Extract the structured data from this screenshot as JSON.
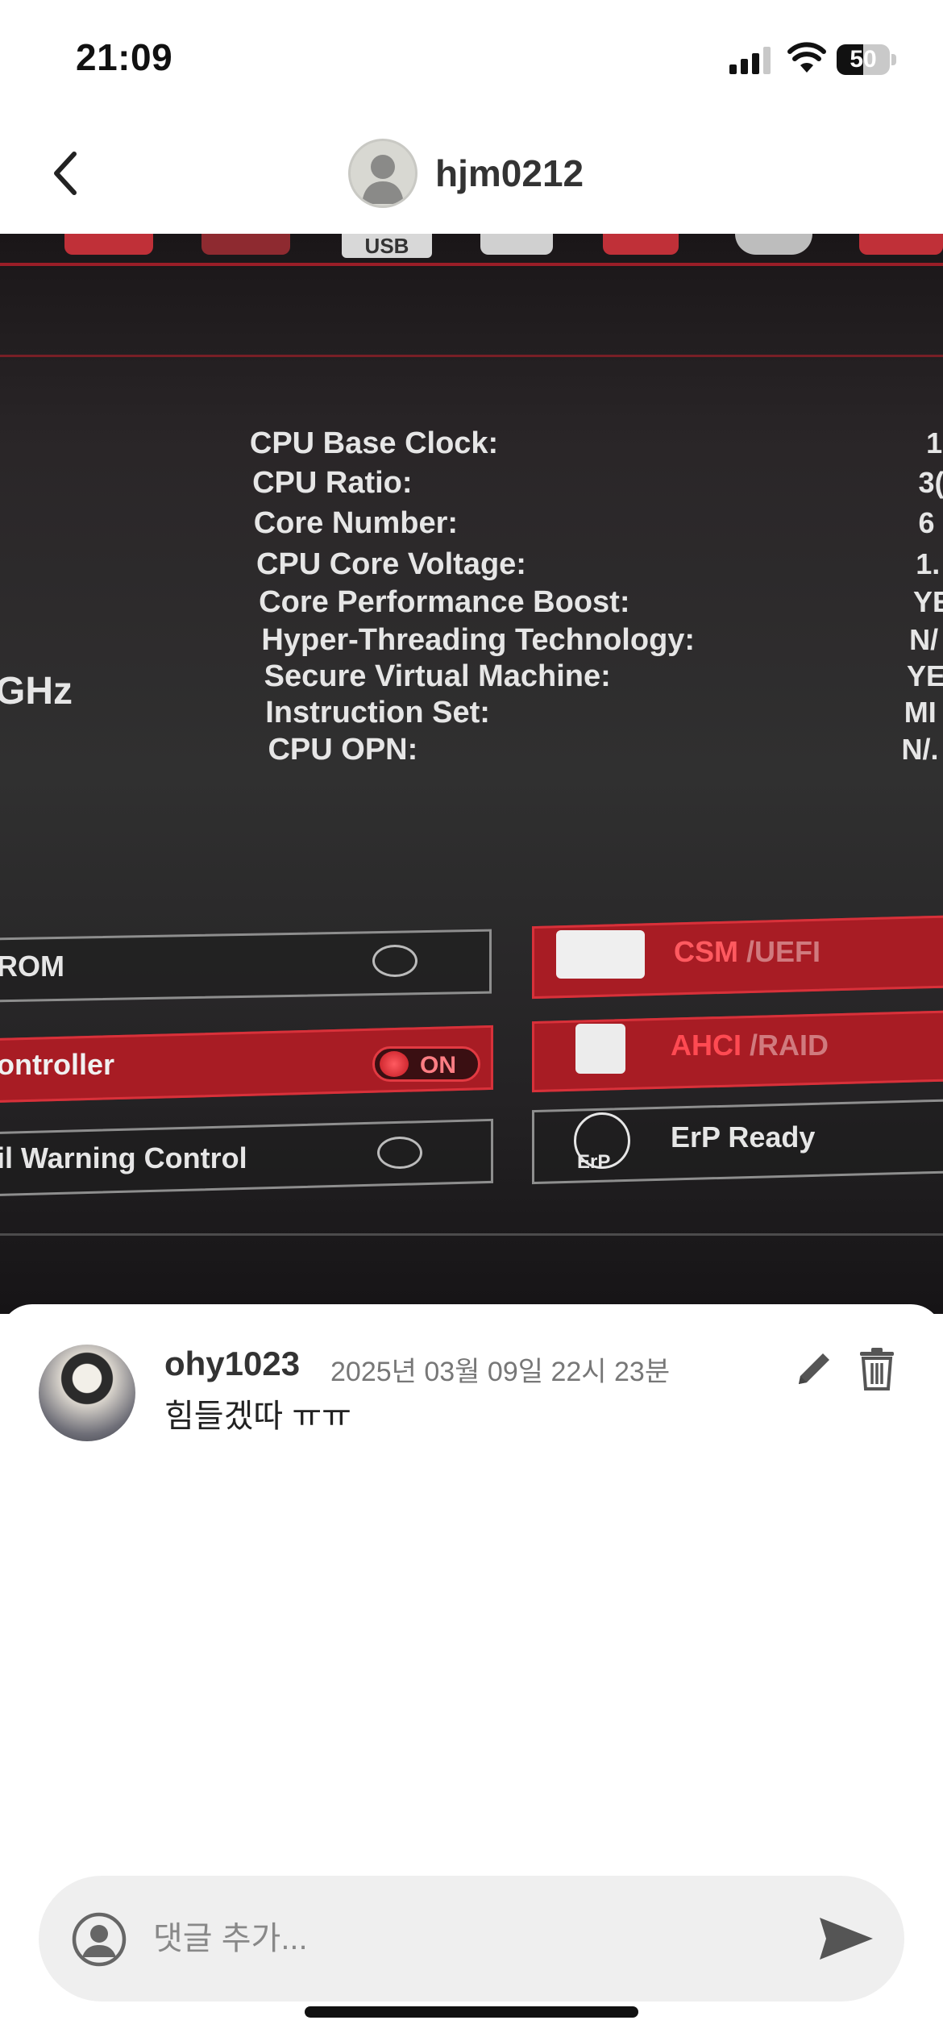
{
  "status_bar": {
    "time": "21:09",
    "battery_level": "50",
    "battery_fraction": 0.5,
    "signal_bars_active": 3,
    "signal_bars_total": 4,
    "icons": [
      "cellular-signal-icon",
      "wifi-icon",
      "battery-icon"
    ]
  },
  "header": {
    "username": "hjm0212",
    "back_icon": "chevron-left-icon",
    "avatar_icon": "default-avatar-icon"
  },
  "photo": {
    "top_tab_label": "USB",
    "cpu_labels": [
      "CPU Base Clock:",
      "CPU Ratio:",
      "Core Number:",
      "CPU Core Voltage:",
      "Core Performance Boost:",
      "Hyper-Threading Technology:",
      "Secure Virtual Machine:",
      "Instruction Set:",
      "CPU OPN:"
    ],
    "cpu_values": [
      "1(",
      "3(",
      "6",
      "1.",
      "YE",
      "N/",
      "YE",
      "MI",
      "N/."
    ],
    "freq_fragment": "GHz",
    "left_toggles": [
      {
        "label": "ROM",
        "state": ""
      },
      {
        "label": "ontroller",
        "state": "ON"
      },
      {
        "label": "il Warning Control",
        "state": ""
      }
    ],
    "right_toggles": [
      {
        "label_active": "CSM",
        "label_rest": " /UEFI"
      },
      {
        "label_active": "AHCI",
        "label_rest": " /RAID"
      },
      {
        "label_active": "",
        "label_rest": "ErP Ready",
        "icon_text": "ErP"
      }
    ]
  },
  "comments": [
    {
      "username": "ohy1023",
      "timestamp": "2025년 03월 09일 22시 23분",
      "text": "힘들겠따 ㅠㅠ"
    }
  ],
  "comment_actions": {
    "edit_icon": "pencil-icon",
    "delete_icon": "trash-icon"
  },
  "composer": {
    "placeholder": "댓글 추가...",
    "value": "",
    "send_icon": "send-icon"
  },
  "colors": {
    "bios_red": "#a81c24",
    "text_dark": "#333333",
    "muted": "#777777",
    "input_bg": "#efefef"
  }
}
